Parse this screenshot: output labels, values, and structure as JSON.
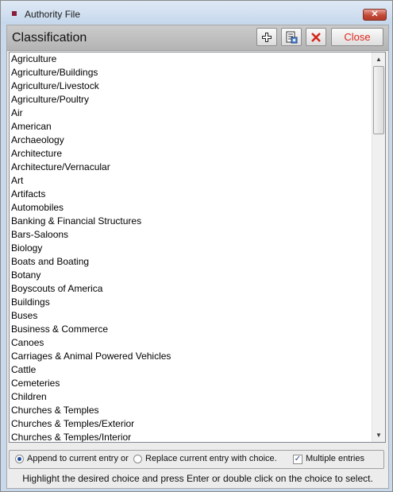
{
  "window": {
    "title": "Authority File",
    "close_glyph": "✕"
  },
  "header": {
    "title": "Classification",
    "close_label": "Close",
    "icons": [
      "add-icon",
      "edit-record-icon",
      "delete-icon"
    ]
  },
  "list": {
    "items": [
      "Agriculture",
      "Agriculture/Buildings",
      "Agriculture/Livestock",
      "Agriculture/Poultry",
      "Air",
      "American",
      "Archaeology",
      "Architecture",
      "Architecture/Vernacular",
      "Art",
      "Artifacts",
      "Automobiles",
      "Banking & Financial Structures",
      "Bars-Saloons",
      "Biology",
      "Boats and Boating",
      "Botany",
      "Boyscouts of America",
      "Buildings",
      "Buses",
      "Business & Commerce",
      "Canoes",
      "Carriages & Animal Powered Vehicles",
      "Cattle",
      "Cemeteries",
      "Children",
      "Churches & Temples",
      "Churches & Temples/Exterior",
      "Churches & Temples/Interior"
    ]
  },
  "scrollbar": {
    "up_glyph": "▲",
    "down_glyph": "▼"
  },
  "options": {
    "append_label": "Append to current entry or",
    "replace_label": "Replace current entry with choice.",
    "multiple_label": "Multiple entries",
    "append_selected": true,
    "multiple_checked": true,
    "check_glyph": "✓"
  },
  "hint": "Highlight the desired choice and press Enter or double click on the choice to select.",
  "colors": {
    "close_text": "#e0281c",
    "delete_icon": "#d62418",
    "app_icon": "#8b1d3c"
  }
}
